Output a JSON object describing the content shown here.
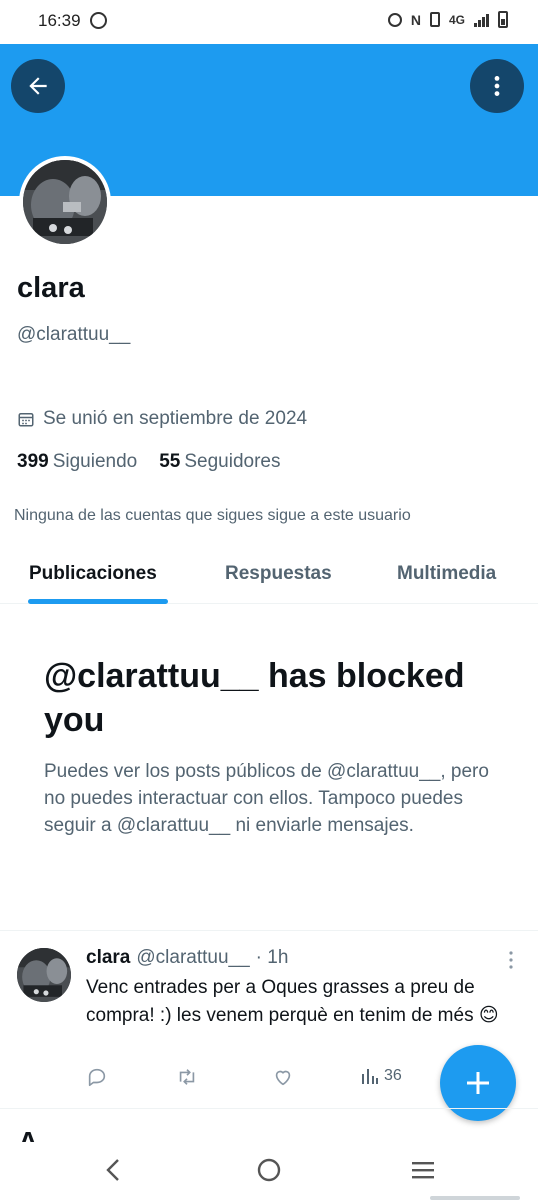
{
  "status_bar": {
    "time": "16:39",
    "network": "4G",
    "icons": [
      "whatsapp-icon",
      "alarm-icon",
      "nfc-icon",
      "vibrate-icon",
      "signal-icon",
      "battery-icon"
    ]
  },
  "colors": {
    "banner": "#1d9bf0",
    "accent": "#1d9bf0",
    "header_button_bg": "#14466b",
    "secondary_text": "#536471",
    "primary_text": "#0f1419"
  },
  "profile": {
    "name": "clara",
    "handle": "@clarattuu__",
    "joined": "Se unió en septiembre de 2024",
    "following_count": "399",
    "following_label": "Siguiendo",
    "followers_count": "55",
    "followers_label": "Seguidores",
    "follow_note": "Ninguna de las cuentas que sigues sigue a este usuario"
  },
  "tabs": [
    {
      "label": "Publicaciones",
      "active": true
    },
    {
      "label": "Respuestas",
      "active": false
    },
    {
      "label": "Multimedia",
      "active": false
    }
  ],
  "blocked": {
    "title": "@clarattuu__ has blocked you",
    "body": "Puedes ver los posts públicos de @clarattuu__, pero no puedes interactuar con ellos. Tampoco puedes seguir a @clarattuu__ ni enviarle mensajes."
  },
  "post": {
    "author": "clara",
    "handle": "@clarattuu__",
    "time": "· 1h",
    "text": "Venc entrades per a Oques grasses a preu de compra! :) les venem perquè en tenim de més 😊",
    "views": "36"
  },
  "next_section_heading": "A ",
  "fab_label": "+"
}
